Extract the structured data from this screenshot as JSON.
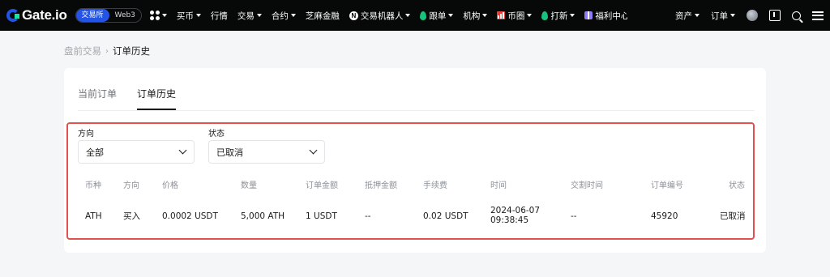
{
  "nav": {
    "logo": "Gate.io",
    "switch": [
      "交易所",
      "Web3"
    ],
    "items": [
      {
        "label": "买币",
        "caret": true
      },
      {
        "label": "行情",
        "caret": false
      },
      {
        "label": "交易",
        "caret": true
      },
      {
        "label": "合约",
        "caret": true
      },
      {
        "label": "芝麻金融",
        "caret": false
      },
      {
        "label": "交易机器人",
        "caret": true,
        "icon": "n-icon"
      },
      {
        "label": "跟单",
        "caret": true,
        "icon": "leaf-icon"
      },
      {
        "label": "机构",
        "caret": true
      },
      {
        "label": "币圈",
        "caret": true,
        "icon": "chart-icon"
      },
      {
        "label": "打新",
        "caret": true,
        "icon": "leaf-icon"
      },
      {
        "label": "福利中心",
        "caret": false,
        "icon": "gift-icon"
      }
    ],
    "right": [
      "资产",
      "订单"
    ]
  },
  "breadcrumb": {
    "parent": "盘前交易",
    "separator": "›",
    "current": "订单历史"
  },
  "tabs": [
    "当前订单",
    "订单历史"
  ],
  "active_tab": 1,
  "filters": [
    {
      "label": "方向",
      "value": "全部"
    },
    {
      "label": "状态",
      "value": "已取消"
    }
  ],
  "table": {
    "headers": [
      "币种",
      "方向",
      "价格",
      "数量",
      "订单金额",
      "抵押金额",
      "手续费",
      "时间",
      "交割时间",
      "订单编号",
      "状态"
    ],
    "rows": [
      {
        "coin": "ATH",
        "side": "买入",
        "price": "0.0002 USDT",
        "amount": "5,000 ATH",
        "order_value": "1 USDT",
        "collateral": "--",
        "fee": "0.02 USDT",
        "date": "2024-06-07",
        "time": "09:38:45",
        "delivery": "--",
        "order_id": "45920",
        "status": "已取消"
      }
    ]
  },
  "colors": {
    "nav_bg": "#070808",
    "brand_blue": "#2354e6",
    "highlight": "#e0524b"
  }
}
